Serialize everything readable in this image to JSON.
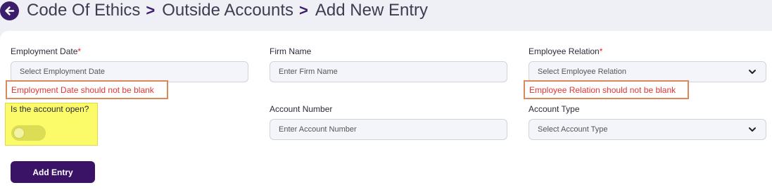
{
  "breadcrumb": {
    "items": [
      "Code Of Ethics",
      "Outside Accounts",
      "Add New Entry"
    ],
    "separator": ">"
  },
  "form": {
    "employment_date": {
      "label": "Employment Date",
      "required_mark": "*",
      "placeholder": "Select Employment Date",
      "error": "Employment Date should not be blank"
    },
    "firm_name": {
      "label": "Firm Name",
      "placeholder": "Enter Firm Name"
    },
    "employee_relation": {
      "label": "Employee Relation",
      "required_mark": "*",
      "selected": "Select Employee Relation",
      "error": "Employee Relation should not be blank"
    },
    "account_open": {
      "label": "Is the account open?",
      "value": false
    },
    "account_number": {
      "label": "Account Number",
      "placeholder": "Enter Account Number"
    },
    "account_type": {
      "label": "Account Type",
      "selected": "Select Account Type"
    },
    "submit_label": "Add Entry"
  },
  "colors": {
    "brand": "#3b1366",
    "error": "#e03535",
    "error_outline": "#d9895a",
    "highlight": "#fbfb6a"
  },
  "icons": {
    "back": "arrow-left-circle-icon",
    "separator": "chevron-right-icon",
    "select": "chevron-down-icon"
  }
}
